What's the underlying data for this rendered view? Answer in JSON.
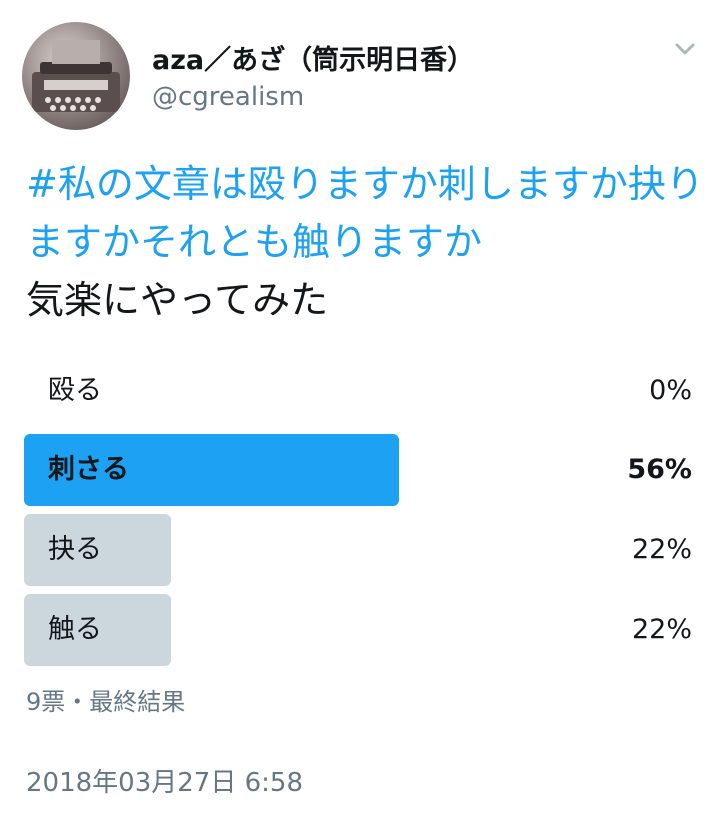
{
  "author": {
    "name": "aza／あざ（筒示明日香）",
    "handle": "@cgrealism",
    "avatar_icon": "typewriter-avatar"
  },
  "menu_icon": "chevron-down-icon",
  "tweet": {
    "hashtag": "#私の文章は殴りますか刺しますか抉りますかそれとも触りますか",
    "text": "気楽にやってみた"
  },
  "poll": {
    "options": [
      {
        "label": "殴る",
        "percent_text": "0%",
        "percent": 0,
        "winner": false
      },
      {
        "label": "刺さる",
        "percent_text": "56%",
        "percent": 56,
        "winner": true
      },
      {
        "label": "抉る",
        "percent_text": "22%",
        "percent": 22,
        "winner": false
      },
      {
        "label": "触る",
        "percent_text": "22%",
        "percent": 22,
        "winner": false
      }
    ],
    "summary": "9票・最終結果"
  },
  "timestamp": "2018年03月27日 6:58",
  "colors": {
    "accent": "#1da1f2",
    "bar": "#ccd6dd",
    "muted": "#657786",
    "text": "#14171a"
  }
}
